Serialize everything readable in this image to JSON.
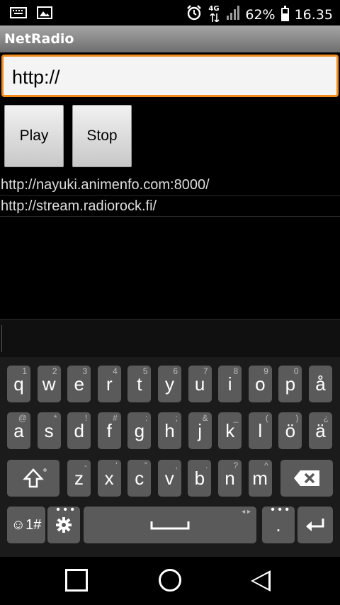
{
  "status_bar": {
    "left_icons": [
      "keyboard-icon",
      "image-icon"
    ],
    "network": "4G",
    "battery": "62%",
    "time": "16.35"
  },
  "app": {
    "title": "NetRadio"
  },
  "url_input": {
    "value": "http://"
  },
  "buttons": {
    "play": "Play",
    "stop": "Stop"
  },
  "stations": [
    "http://nayuki.animenfo.com:8000/",
    "http://stream.radiorock.fi/"
  ],
  "keyboard": {
    "row1": [
      {
        "k": "q",
        "h": "1"
      },
      {
        "k": "w",
        "h": "2"
      },
      {
        "k": "e",
        "h": "3"
      },
      {
        "k": "r",
        "h": "4"
      },
      {
        "k": "t",
        "h": "5"
      },
      {
        "k": "y",
        "h": "6"
      },
      {
        "k": "u",
        "h": "7"
      },
      {
        "k": "i",
        "h": "8"
      },
      {
        "k": "o",
        "h": "9"
      },
      {
        "k": "p",
        "h": "0"
      },
      {
        "k": "å",
        "h": ""
      }
    ],
    "row2": [
      {
        "k": "a",
        "h": "@"
      },
      {
        "k": "s",
        "h": "*"
      },
      {
        "k": "d",
        "h": "!"
      },
      {
        "k": "f",
        "h": "#"
      },
      {
        "k": "g",
        "h": ":"
      },
      {
        "k": "h",
        "h": ";"
      },
      {
        "k": "j",
        "h": "&"
      },
      {
        "k": "k",
        "h": "_"
      },
      {
        "k": "l",
        "h": "("
      },
      {
        "k": "ö",
        "h": ")"
      },
      {
        "k": "ä",
        "h": "¿"
      }
    ],
    "row3": [
      {
        "k": "z",
        "h": "-"
      },
      {
        "k": "x",
        "h": "'"
      },
      {
        "k": "c",
        "h": "\""
      },
      {
        "k": "v",
        "h": ","
      },
      {
        "k": "b",
        "h": "."
      },
      {
        "k": "n",
        "h": "?"
      },
      {
        "k": "m",
        "h": "^"
      }
    ],
    "emoji_label": "☺1#",
    "period": "."
  }
}
